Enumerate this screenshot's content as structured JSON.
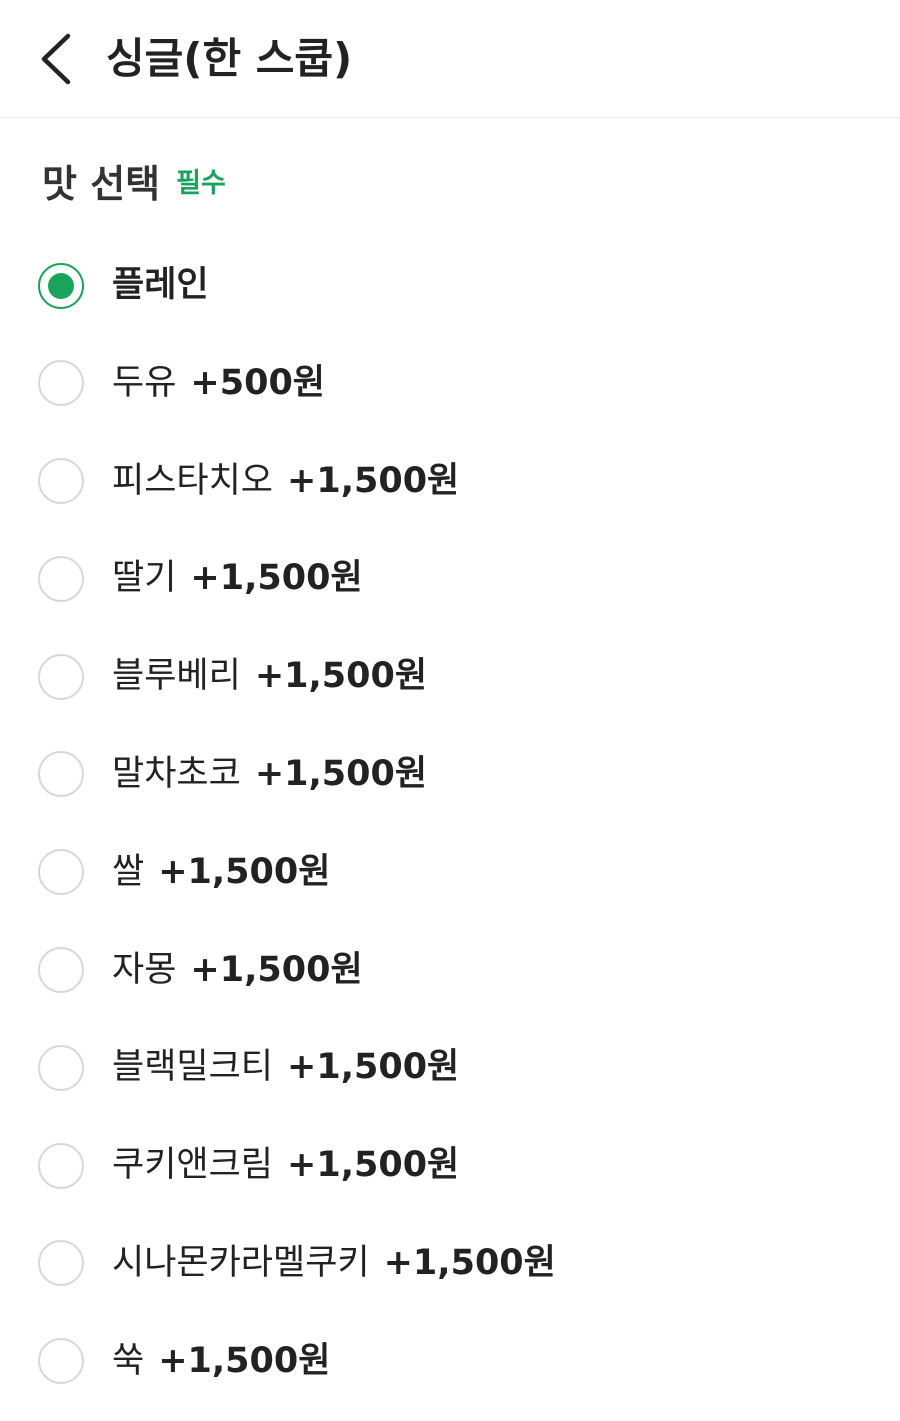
{
  "header": {
    "title": "싱글(한 스쿱)",
    "back_icon": "chevron-left-icon"
  },
  "section": {
    "title": "맛 선택",
    "required_label": "필수"
  },
  "colors": {
    "accent": "#1ba35b",
    "text": "#222222",
    "radio_border": "#d8d8d8"
  },
  "options": [
    {
      "name": "플레인",
      "price": "",
      "selected": true
    },
    {
      "name": "두유",
      "price": "+500원",
      "selected": false
    },
    {
      "name": "피스타치오",
      "price": "+1,500원",
      "selected": false
    },
    {
      "name": "딸기",
      "price": "+1,500원",
      "selected": false
    },
    {
      "name": "블루베리",
      "price": "+1,500원",
      "selected": false
    },
    {
      "name": "말차초코",
      "price": "+1,500원",
      "selected": false
    },
    {
      "name": "쌀",
      "price": "+1,500원",
      "selected": false
    },
    {
      "name": "자몽",
      "price": "+1,500원",
      "selected": false
    },
    {
      "name": "블랙밀크티",
      "price": "+1,500원",
      "selected": false
    },
    {
      "name": "쿠키앤크림",
      "price": "+1,500원",
      "selected": false
    },
    {
      "name": "시나몬카라멜쿠키",
      "price": "+1,500원",
      "selected": false
    },
    {
      "name": "쑥",
      "price": "+1,500원",
      "selected": false
    }
  ]
}
